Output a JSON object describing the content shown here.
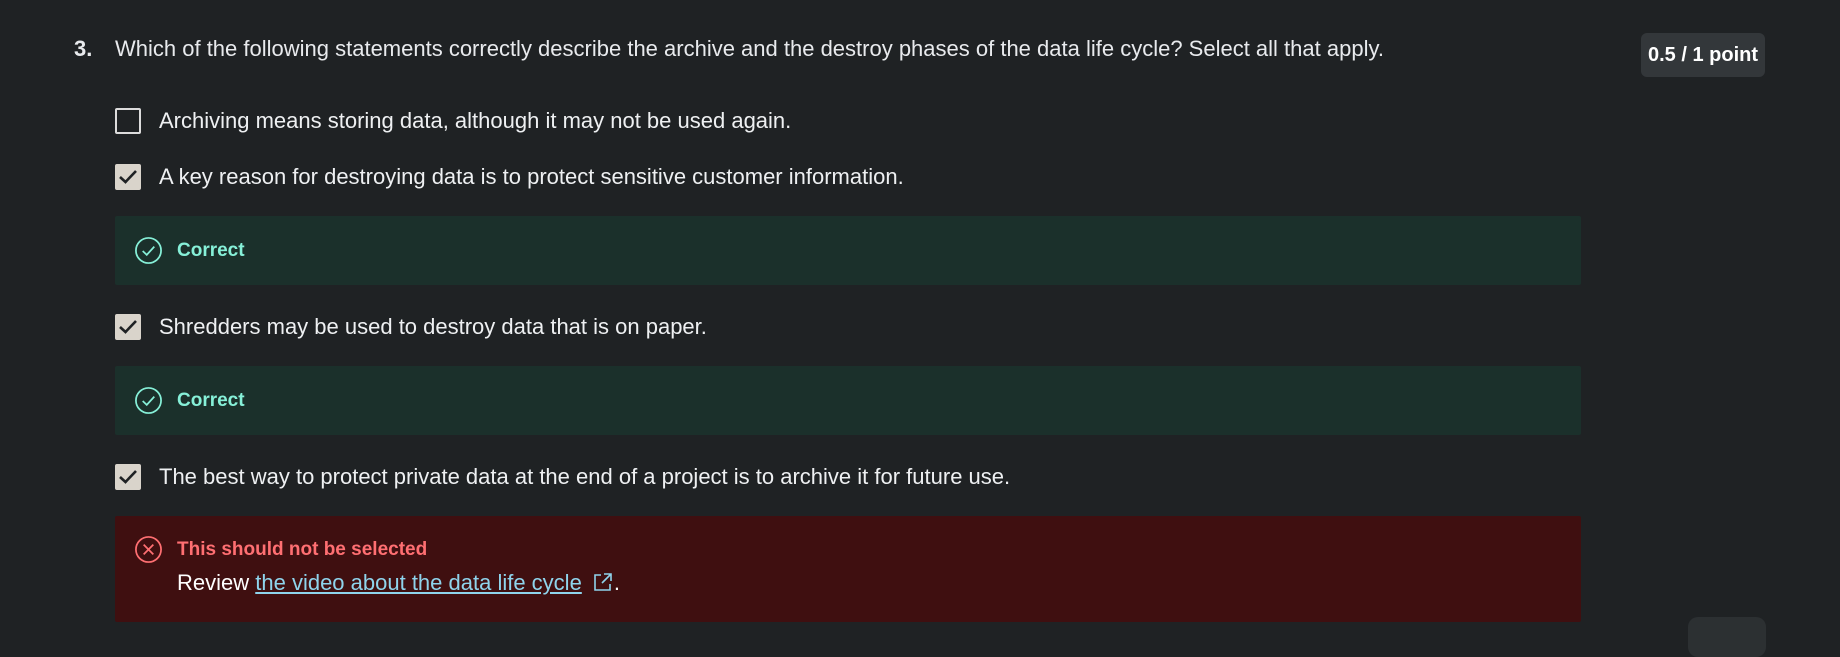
{
  "question": {
    "number": "3.",
    "text": "Which of the following statements correctly describe the archive and the destroy phases of the data life cycle? Select all that apply.",
    "score": "0.5 / 1 point"
  },
  "options": [
    {
      "text": "Archiving means storing data, although it may not be used again.",
      "checked": false
    },
    {
      "text": "A key reason for destroying data is to protect sensitive customer information.",
      "checked": true,
      "feedback": {
        "label": "Correct",
        "status": "correct",
        "icon": "check-circle-icon"
      }
    },
    {
      "text": "Shredders may be used to destroy data that is on paper.",
      "checked": true,
      "feedback": {
        "label": "Correct",
        "status": "correct",
        "icon": "check-circle-icon"
      }
    },
    {
      "text": "The best way to protect private data at the end of a project is to archive it for future use.",
      "checked": true,
      "feedback": {
        "label": "This should not be selected",
        "status": "incorrect",
        "icon": "x-circle-icon",
        "review_prefix": "Review ",
        "review_link": "the video about the data life cycle",
        "review_suffix": "."
      }
    }
  ],
  "colors": {
    "background": "#1f2224",
    "correct_bg": "#1b302b",
    "correct_text": "#86f0d8",
    "incorrect_bg": "#3f0f10",
    "incorrect_text": "#ff6f72",
    "link": "#8fd4ec"
  }
}
